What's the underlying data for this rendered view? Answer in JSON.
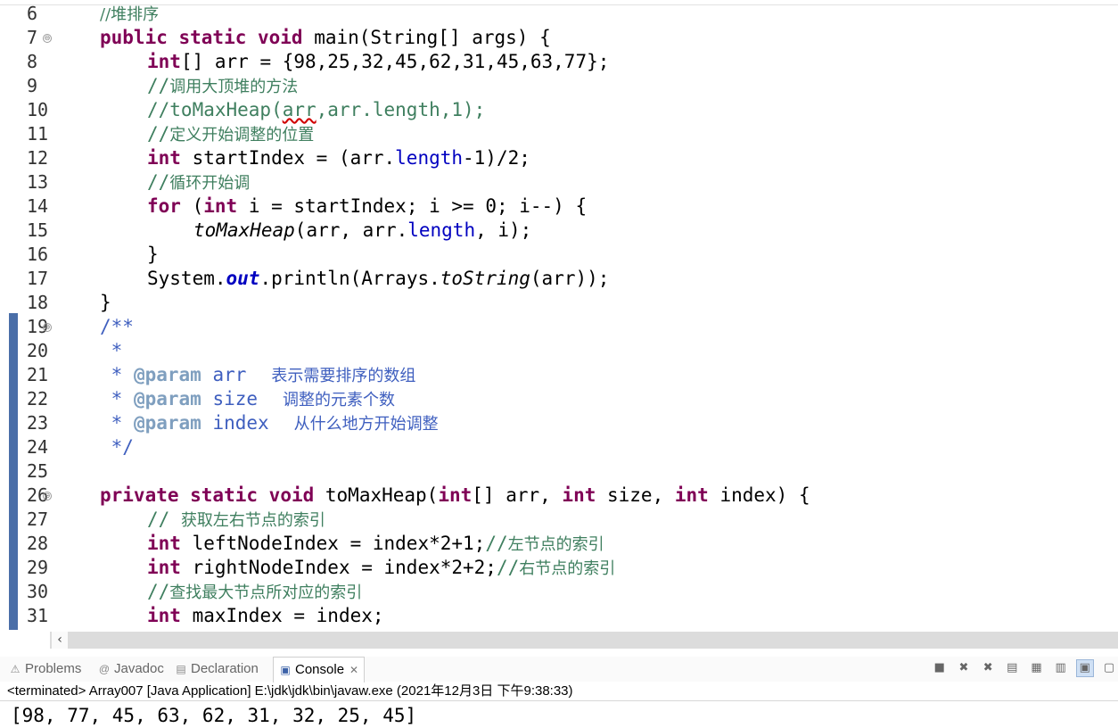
{
  "editor": {
    "line_numbers": [
      "6",
      "7",
      "8",
      "9",
      "10",
      "11",
      "12",
      "13",
      "14",
      "15",
      "16",
      "17",
      "18",
      "19",
      "20",
      "21",
      "22",
      "23",
      "24",
      "25",
      "26",
      "27",
      "28",
      "29",
      "30",
      "31"
    ],
    "fold_marker": "⊖",
    "line6": {
      "comment": "//堆排序"
    },
    "line7": {
      "kw": "public static void",
      "rest": " main(String[] args) {"
    },
    "line8": {
      "kw": "int",
      "rest": "[] arr = {98,25,32,45,62,31,45,63,77};"
    },
    "line9": {
      "slashes": "//",
      "text": "调用大顶堆的方法"
    },
    "line10": {
      "a": "//toMaxHeap(",
      "err": "arr",
      "b": ",arr.length,1);"
    },
    "line11": {
      "slashes": "//",
      "text": "定义开始调整的位置"
    },
    "line12": {
      "kw": "int",
      "a": " startIndex = (arr.",
      "field": "length",
      "b": "-1)/2;"
    },
    "line13": {
      "slashes": "//",
      "text": "循环开始调"
    },
    "line14": {
      "kw1": "for",
      "a": " (",
      "kw2": "int",
      "b": " i = startIndex; i >= 0; i--) {"
    },
    "line15": {
      "method": "toMaxHeap",
      "a": "(arr, arr.",
      "field": "length",
      "b": ", i);"
    },
    "line16": {
      "text": "}"
    },
    "line17": {
      "a": "System.",
      "static_field": "out",
      "b": ".println(Arrays.",
      "method": "toString",
      "c": "(arr));"
    },
    "line18": {
      "text": "}"
    },
    "line19": {
      "text": "/**"
    },
    "line20": {
      "text": " *"
    },
    "line21": {
      "star": " * ",
      "tag": "@param",
      "param": " arr",
      "desc": "表示需要排序的数组"
    },
    "line22": {
      "star": " * ",
      "tag": "@param",
      "param": " size",
      "desc": "调整的元素个数"
    },
    "line23": {
      "star": " * ",
      "tag": "@param",
      "param": " index",
      "desc": "从什么地方开始调整"
    },
    "line24": {
      "text": " */"
    },
    "line26": {
      "kw1": "private static",
      "a": " toMaxHeap(",
      "kw0": "void",
      "kw2": "int",
      "b": "[] arr, ",
      "kw3": "int",
      "c": " size, ",
      "kw4": "int",
      "d": " index) {"
    },
    "line27": {
      "slashes": "// ",
      "text": "获取左右节点的索引"
    },
    "line28": {
      "kw": "int",
      "a": " leftNodeIndex = index*2+1;",
      "slashes": "//",
      "comment": "左节点的索引"
    },
    "line29": {
      "kw": "int",
      "a": " rightNodeIndex = index*2+2;",
      "slashes": "//",
      "comment": "右节点的索引"
    },
    "line30": {
      "slashes": "//",
      "text": "查找最大节点所对应的索引"
    },
    "line31": {
      "kw": "int",
      "a": " maxIndex = index;"
    }
  },
  "scrollbar": {
    "left_arrow": "‹"
  },
  "tabs": [
    {
      "label": "Problems",
      "icon": "problems-icon",
      "glyph": "⚠"
    },
    {
      "label": "Javadoc",
      "icon": "javadoc-icon",
      "glyph": "@"
    },
    {
      "label": "Declaration",
      "icon": "declaration-icon",
      "glyph": "▤"
    },
    {
      "label": "Console",
      "icon": "console-icon",
      "glyph": "▣",
      "close": "✕"
    }
  ],
  "console": {
    "header": "<terminated> Array007 [Java Application] E:\\jdk\\jdk\\bin\\javaw.exe (2021年12月3日 下午9:38:33)",
    "output": "[98, 77, 45, 63, 62, 31, 32, 25, 45]"
  },
  "colors": {
    "keyword": "#7f0055",
    "comment": "#3f7f5f",
    "javadoc": "#3f5fbf",
    "field": "#0000c0",
    "bookmark": "#4a6ea8"
  }
}
